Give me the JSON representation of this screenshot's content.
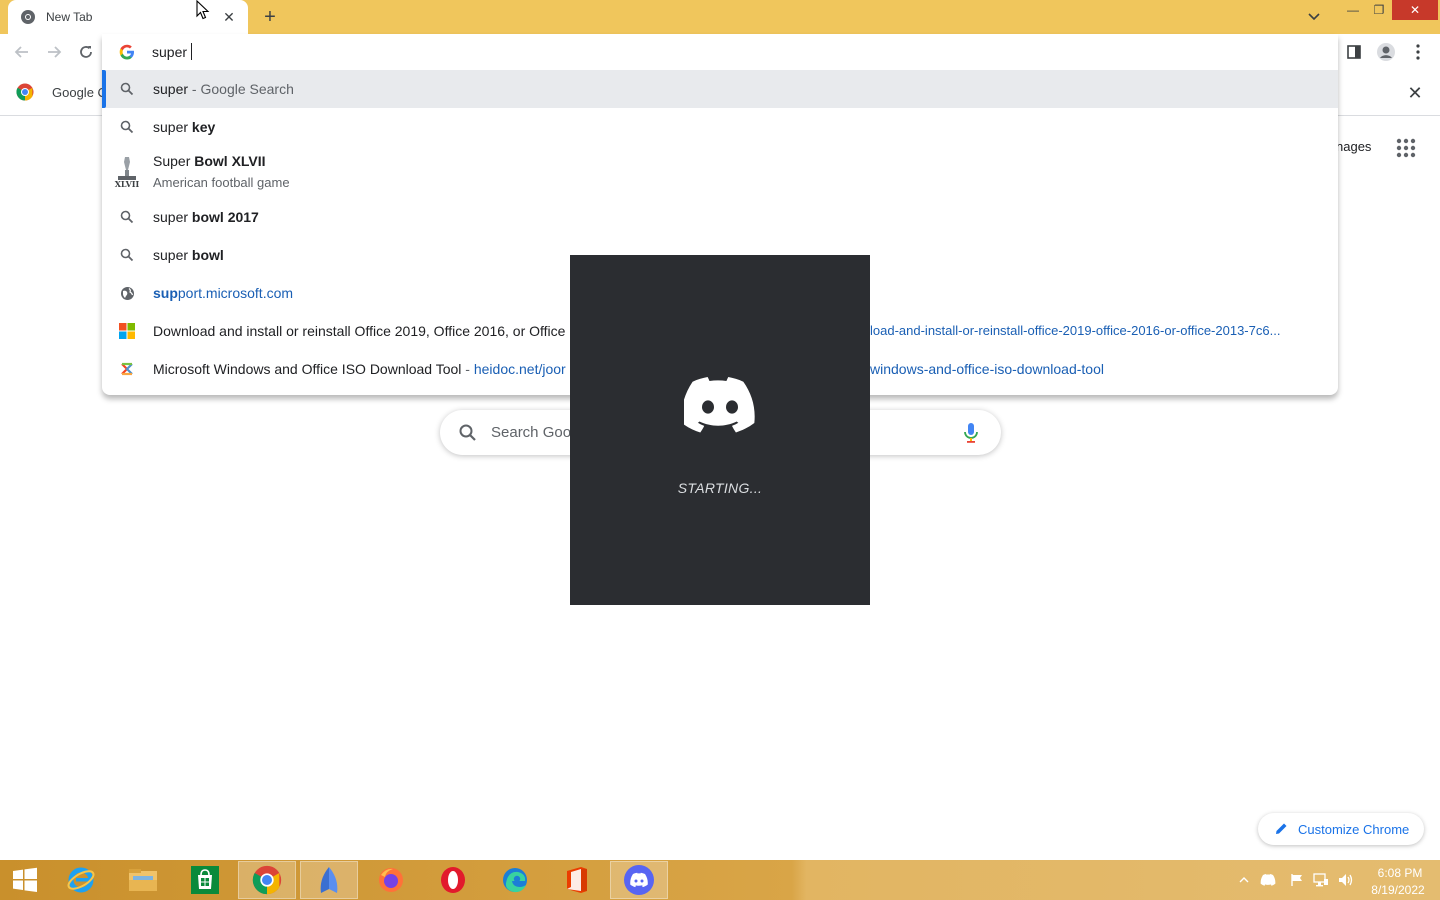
{
  "browser": {
    "tab": {
      "title": "New Tab"
    },
    "new_tab_symbol": "+",
    "bookmark": {
      "label": "Google C"
    },
    "window_controls": {
      "minimize": "—",
      "maximize": "❐",
      "close": "✕"
    }
  },
  "omnibox": {
    "value": "super ",
    "suggestions": [
      {
        "pre": "super",
        "sep": " - ",
        "post": "Google Search"
      },
      {
        "pre": "super ",
        "bold": "key"
      },
      {
        "pre": "Super ",
        "bold": "Bowl XLVII",
        "sub": "American football game"
      },
      {
        "pre": "super ",
        "bold": "bowl 2017"
      },
      {
        "pre": "super ",
        "bold": "bowl"
      },
      {
        "bold": "sup",
        "post": "port.microsoft.com"
      },
      {
        "text": "Download and install or reinstall Office 2019, Office 2016, or Office 2",
        "url": "load-and-install-or-reinstall-office-2019-office-2016-or-office-2013-7c6..."
      },
      {
        "text": "Microsoft Windows and Office ISO Download Tool",
        "sep": " - ",
        "url1": "heidoc.net/joor",
        "url2": "windows-and-office-iso-download-tool"
      }
    ]
  },
  "ntp": {
    "images_label": "nages",
    "search_placeholder": "Search Goo",
    "customize_label": "Customize Chrome"
  },
  "discord": {
    "status": "STARTING..."
  },
  "taskbar": {
    "time": "6:08 PM",
    "date": "8/19/2022"
  },
  "colors": {
    "tabstrip": "#f0c65c",
    "discord_bg": "#2b2d31",
    "accent_blue": "#1a73e8"
  }
}
